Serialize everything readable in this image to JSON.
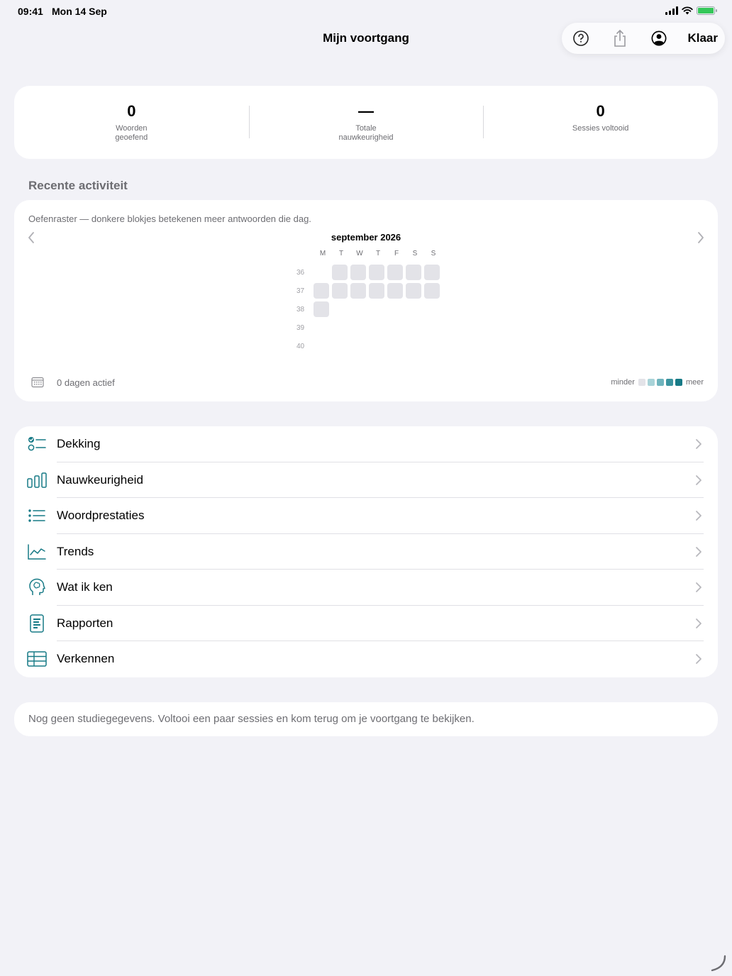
{
  "status_bar": {
    "time": "09:41",
    "date": "Mon 14 Sep"
  },
  "nav": {
    "title": "Mijn voortgang",
    "done_label": "Klaar",
    "icons": [
      "help-icon",
      "share-icon",
      "account-icon"
    ]
  },
  "stats": [
    {
      "value": "0",
      "label": "Woorden geoefend"
    },
    {
      "value": "—",
      "label": "Totale nauwkeurigheid"
    },
    {
      "value": "0",
      "label": "Sessies voltooid"
    }
  ],
  "recent": {
    "header": "Recente activiteit",
    "caption": "Oefenraster — donkere blokjes betekenen meer antwoorden die dag.",
    "month": "september 2026",
    "weekdays": [
      "M",
      "T",
      "W",
      "T",
      "F",
      "S",
      "S"
    ],
    "weeks": [
      {
        "num": "36",
        "days": [
          0,
          1,
          1,
          1,
          1,
          1,
          1
        ]
      },
      {
        "num": "37",
        "days": [
          1,
          1,
          1,
          1,
          1,
          1,
          1
        ]
      },
      {
        "num": "38",
        "days": [
          1,
          0,
          0,
          0,
          0,
          0,
          0
        ]
      },
      {
        "num": "39",
        "days": [
          0,
          0,
          0,
          0,
          0,
          0,
          0
        ]
      },
      {
        "num": "40",
        "days": [
          0,
          0,
          0,
          0,
          0,
          0,
          0
        ]
      }
    ],
    "days_active": "0 dagen actief",
    "legend_less": "minder",
    "legend_more": "meer",
    "legend_colors": [
      "#e3e3e8",
      "#a8d3d8",
      "#6fb4bd",
      "#3b949f",
      "#177a86"
    ]
  },
  "menu": [
    {
      "label": "Dekking",
      "icon": "checklist-icon"
    },
    {
      "label": "Nauwkeurigheid",
      "icon": "bar-chart-icon"
    },
    {
      "label": "Woordprestaties",
      "icon": "list-icon"
    },
    {
      "label": "Trends",
      "icon": "line-chart-icon"
    },
    {
      "label": "Wat ik ken",
      "icon": "brain-head-icon"
    },
    {
      "label": "Rapporten",
      "icon": "report-icon"
    },
    {
      "label": "Verkennen",
      "icon": "table-icon"
    }
  ],
  "empty_message": "Nog geen studiegegevens. Voltooi een paar sessies en kom terug om je voortgang te bekijken.",
  "colors": {
    "accent": "#177a86",
    "background": "#f2f2f7"
  }
}
